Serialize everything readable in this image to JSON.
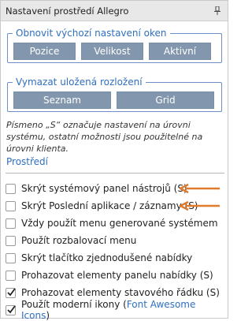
{
  "panel": {
    "title": "Nastavení prostředí Allegro",
    "pin_icon": "pin-icon"
  },
  "window_reset": {
    "legend": "Obnovit výchozí nastavení oken",
    "buttons": [
      {
        "label": "Pozice"
      },
      {
        "label": "Velikost"
      },
      {
        "label": "Aktivní"
      }
    ]
  },
  "layout_clear": {
    "legend": "Vymazat uložená rozložení",
    "buttons": [
      {
        "label": "Seznam"
      },
      {
        "label": "Grid"
      }
    ]
  },
  "note": "Písmeno „S“ označuje nastavení na úrovni systému, ostatní možnosti jsou použitelné na úrovni klienta.",
  "environment": {
    "title": "Prostředí",
    "options": [
      {
        "label": "Skrýt systémový panel nástrojů (S)",
        "checked": false
      },
      {
        "label": "Skrýt Poslední aplikace / záznamy (S)",
        "checked": false
      },
      {
        "label": "Vždy použít menu generované systémem",
        "checked": false
      },
      {
        "label": "Použít rozbalovací menu",
        "checked": false
      },
      {
        "label": "Skrýt tlačítko zjednodušené nabídky",
        "checked": false
      },
      {
        "label": "Prohazovat elementy panelu nabídky (S)",
        "checked": false
      },
      {
        "label": "Prohazovat elementy stavového řádku (S)",
        "checked": true
      },
      {
        "label_prefix": "Použít moderní ikony (",
        "link": "Font Awesome Icons",
        "label_suffix": ")",
        "checked": true
      }
    ]
  },
  "colors": {
    "accent": "#2f6fc0",
    "button": "#8297ae",
    "arrow": "#e07b2c"
  }
}
